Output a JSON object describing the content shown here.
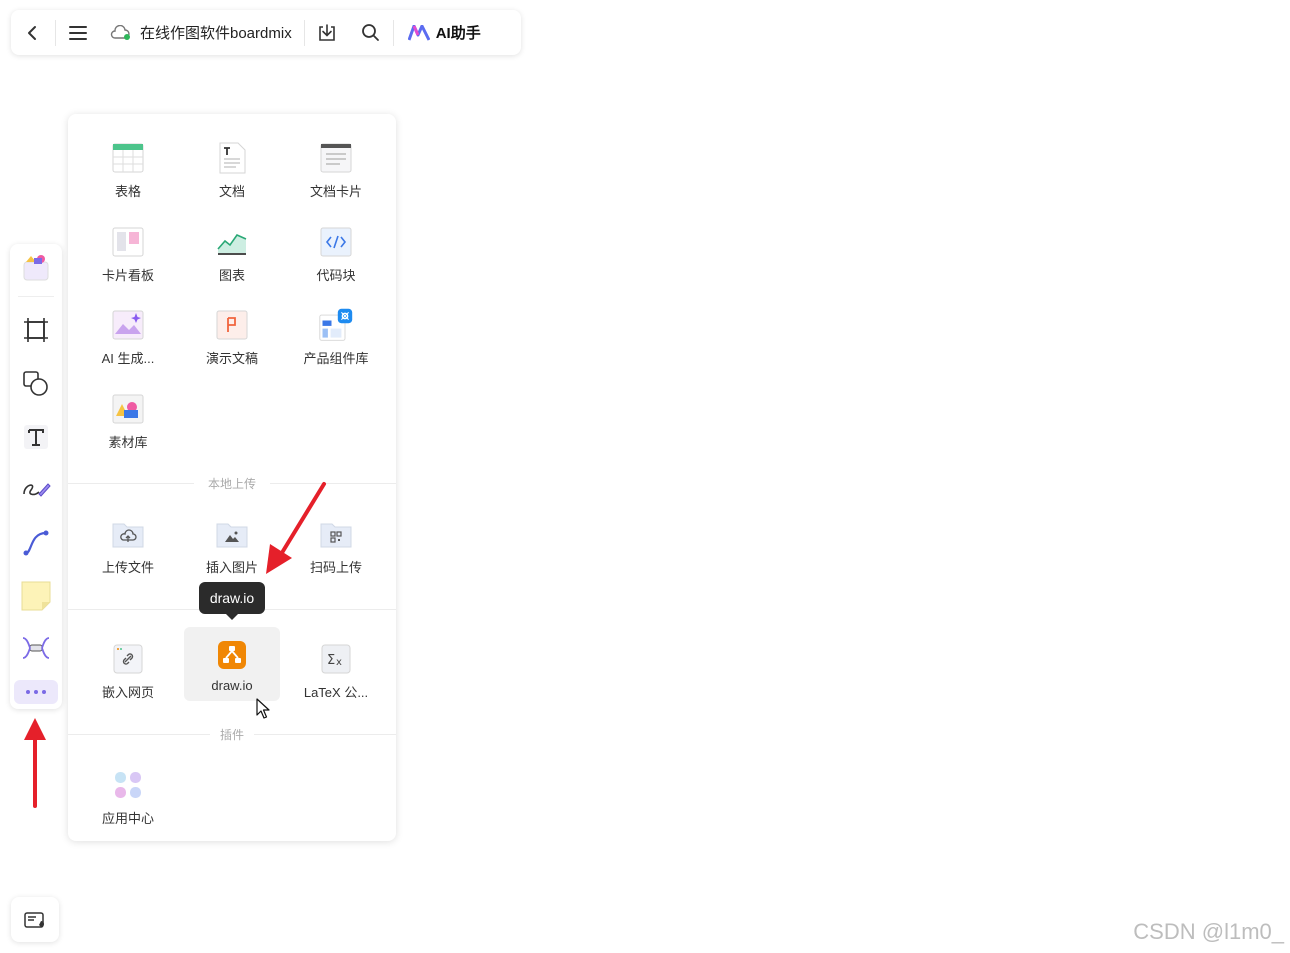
{
  "topbar": {
    "back_icon": "chevron-left-icon",
    "menu_icon": "hamburger-menu-icon",
    "cloud_icon": "cloud-synced-icon",
    "title": "在线作图软件boardmix",
    "download_icon": "download-icon",
    "search_icon": "search-icon",
    "ai_label": "AI助手"
  },
  "left_toolbar": {
    "items": [
      "templates-icon",
      "frame-icon",
      "shape-icon",
      "text-icon",
      "pen-icon",
      "connector-icon",
      "sticky-note-icon",
      "mindmap-icon",
      "more-icon"
    ]
  },
  "panel": {
    "grid": [
      {
        "label": "表格",
        "icon": "table-icon"
      },
      {
        "label": "文档",
        "icon": "document-icon"
      },
      {
        "label": "文档卡片",
        "icon": "doc-card-icon"
      },
      {
        "label": "卡片看板",
        "icon": "kanban-icon"
      },
      {
        "label": "图表",
        "icon": "chart-icon"
      },
      {
        "label": "代码块",
        "icon": "code-block-icon"
      },
      {
        "label": "AI 生成...",
        "icon": "ai-image-icon"
      },
      {
        "label": "演示文稿",
        "icon": "presentation-icon"
      },
      {
        "label": "产品组件库",
        "icon": "component-library-icon"
      },
      {
        "label": "素材库",
        "icon": "asset-library-icon"
      }
    ],
    "upload_section": "本地上传",
    "upload_items": [
      {
        "label": "上传文件",
        "icon": "upload-file-icon"
      },
      {
        "label": "插入图片",
        "icon": "insert-image-icon"
      },
      {
        "label": "扫码上传",
        "icon": "qr-upload-icon"
      }
    ],
    "embed_items": [
      {
        "label": "嵌入网页",
        "icon": "embed-web-icon"
      },
      {
        "label": "draw.io",
        "icon": "drawio-icon"
      },
      {
        "label": "LaTeX 公...",
        "icon": "latex-icon"
      }
    ],
    "plugin_section": "插件",
    "plugin_items": [
      {
        "label": "应用中心",
        "icon": "app-center-icon"
      }
    ]
  },
  "tooltip": "draw.io",
  "watermark": "CSDN @l1m0_",
  "colors": {
    "accent": "#7b6ae6",
    "arrow": "#e5202a",
    "drawio": "#f08705"
  }
}
